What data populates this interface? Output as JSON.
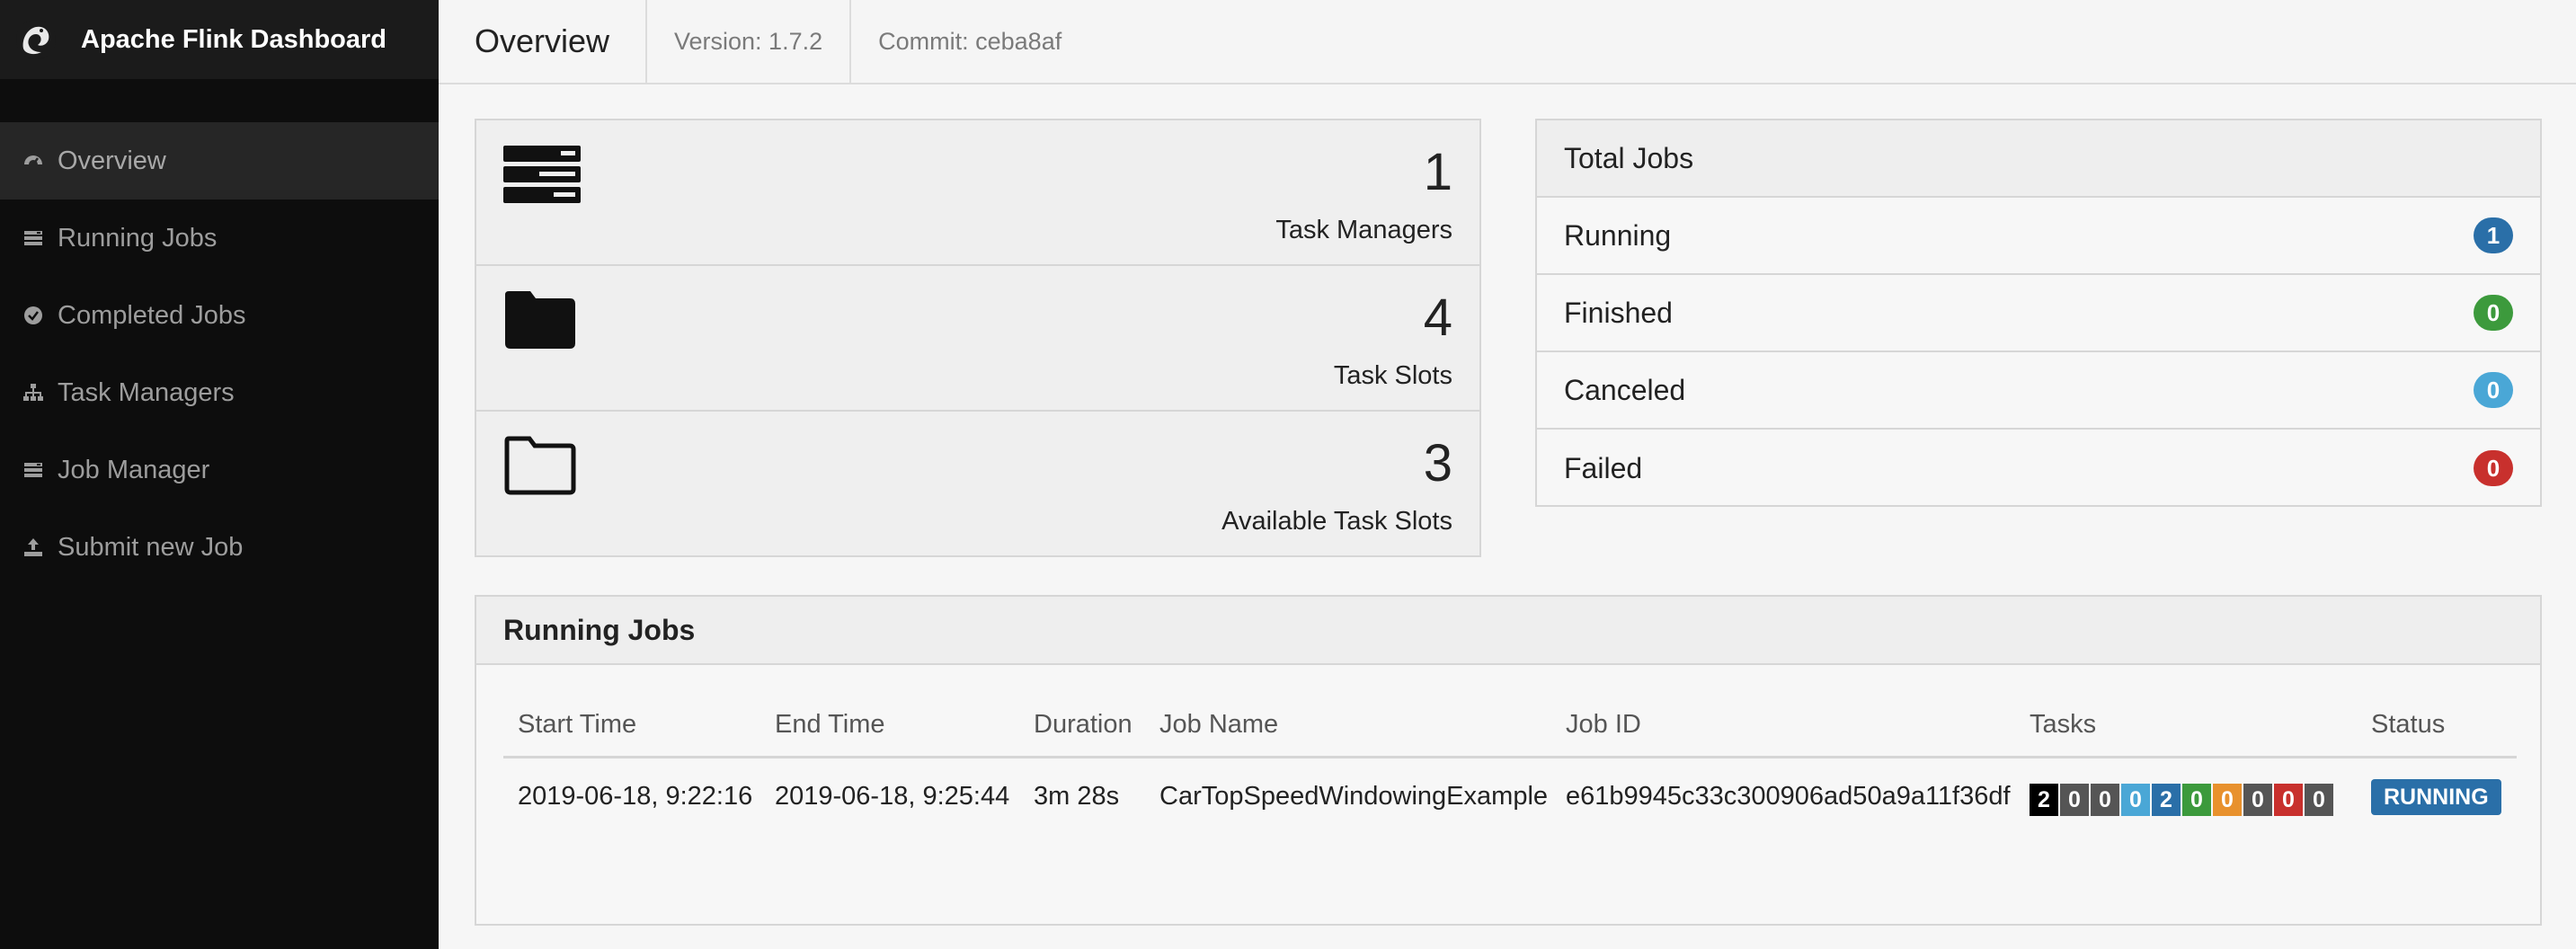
{
  "app": {
    "title": "Apache Flink Dashboard"
  },
  "sidebar": {
    "items": [
      {
        "label": "Overview",
        "icon": "dashboard-icon",
        "active": true
      },
      {
        "label": "Running Jobs",
        "icon": "list-icon",
        "active": false
      },
      {
        "label": "Completed Jobs",
        "icon": "check-circle-icon",
        "active": false
      },
      {
        "label": "Task Managers",
        "icon": "sitemap-icon",
        "active": false
      },
      {
        "label": "Job Manager",
        "icon": "list-icon",
        "active": false
      },
      {
        "label": "Submit new Job",
        "icon": "upload-icon",
        "active": false
      }
    ]
  },
  "header": {
    "title": "Overview",
    "version": "Version: 1.7.2",
    "commit": "Commit: ceba8af"
  },
  "stats": [
    {
      "value": "1",
      "label": "Task Managers",
      "icon": "server-icon"
    },
    {
      "value": "4",
      "label": "Task Slots",
      "icon": "folder-icon"
    },
    {
      "value": "3",
      "label": "Available Task Slots",
      "icon": "folder-open-icon"
    }
  ],
  "totals": {
    "title": "Total Jobs",
    "rows": [
      {
        "label": "Running",
        "count": "1",
        "color": "#2a6fa8"
      },
      {
        "label": "Finished",
        "count": "0",
        "color": "#3c9a3c"
      },
      {
        "label": "Canceled",
        "count": "0",
        "color": "#4aa7d6"
      },
      {
        "label": "Failed",
        "count": "0",
        "color": "#c8302d"
      }
    ]
  },
  "running_jobs": {
    "title": "Running Jobs",
    "columns": [
      "Start Time",
      "End Time",
      "Duration",
      "Job Name",
      "Job ID",
      "Tasks",
      "Status"
    ],
    "rows": [
      {
        "start_time": "2019-06-18, 9:22:16",
        "end_time": "2019-06-18, 9:25:44",
        "duration": "3m 28s",
        "job_name": "CarTopSpeedWindowingExample",
        "job_id": "e61b9945c33c300906ad50a9a11f36df",
        "tasks": [
          {
            "value": "2",
            "color": "#000000"
          },
          {
            "value": "0",
            "color": "#555555"
          },
          {
            "value": "0",
            "color": "#555555"
          },
          {
            "value": "0",
            "color": "#4aa7d6"
          },
          {
            "value": "2",
            "color": "#2a6fa8"
          },
          {
            "value": "0",
            "color": "#3c9a3c"
          },
          {
            "value": "0",
            "color": "#e8912d"
          },
          {
            "value": "0",
            "color": "#555555"
          },
          {
            "value": "0",
            "color": "#c8302d"
          },
          {
            "value": "0",
            "color": "#555555"
          }
        ],
        "status": "RUNNING"
      }
    ]
  }
}
